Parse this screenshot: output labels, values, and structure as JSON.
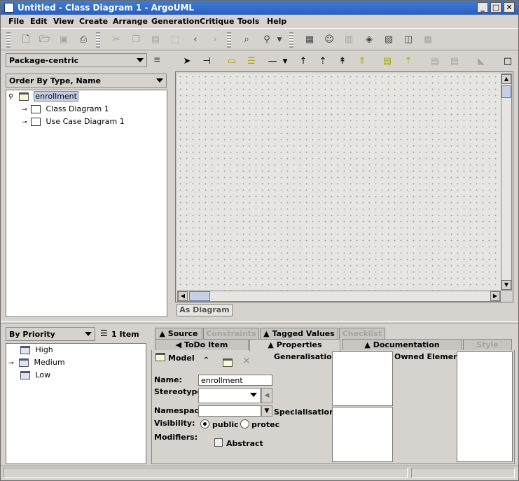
{
  "window": {
    "title": "Untitled - Class Diagram 1 - ArgoUML"
  },
  "menu": [
    "File",
    "Edit",
    "View",
    "Create",
    "Arrange",
    "Generation",
    "Critique",
    "Tools",
    "Help"
  ],
  "explorer": {
    "perspective": "Package-centric",
    "order": "Order By Type, Name",
    "root": "enrollment",
    "children": [
      "Class Diagram 1",
      "Use Case Diagram 1"
    ]
  },
  "diagram": {
    "tab": "As Diagram"
  },
  "todo": {
    "sort": "By Priority",
    "count": "1 Item",
    "items": [
      "High",
      "Medium",
      "Low"
    ]
  },
  "details": {
    "tabs_top": [
      "Source",
      "Constraints",
      "Tagged Values",
      "Checklist"
    ],
    "tabs_bottom": [
      "ToDo Item",
      "Properties",
      "Documentation",
      "Style"
    ],
    "element_type": "Model",
    "labels": {
      "name": "Name:",
      "stereotype": "Stereotype:",
      "namespace": "Namespace:",
      "visibility": "Visibility:",
      "modifiers": "Modifiers:",
      "generalisations": "Generalisations:",
      "specialisations": "Specialisations:",
      "owned": "Owned Elements:"
    },
    "name_value": "enrollment",
    "visibility_public": "public",
    "visibility_protected": "protec",
    "abstract_label": "Abstract"
  },
  "colors": {
    "title_bar": "#2a5fbf",
    "selection": "#c5d0e6"
  }
}
